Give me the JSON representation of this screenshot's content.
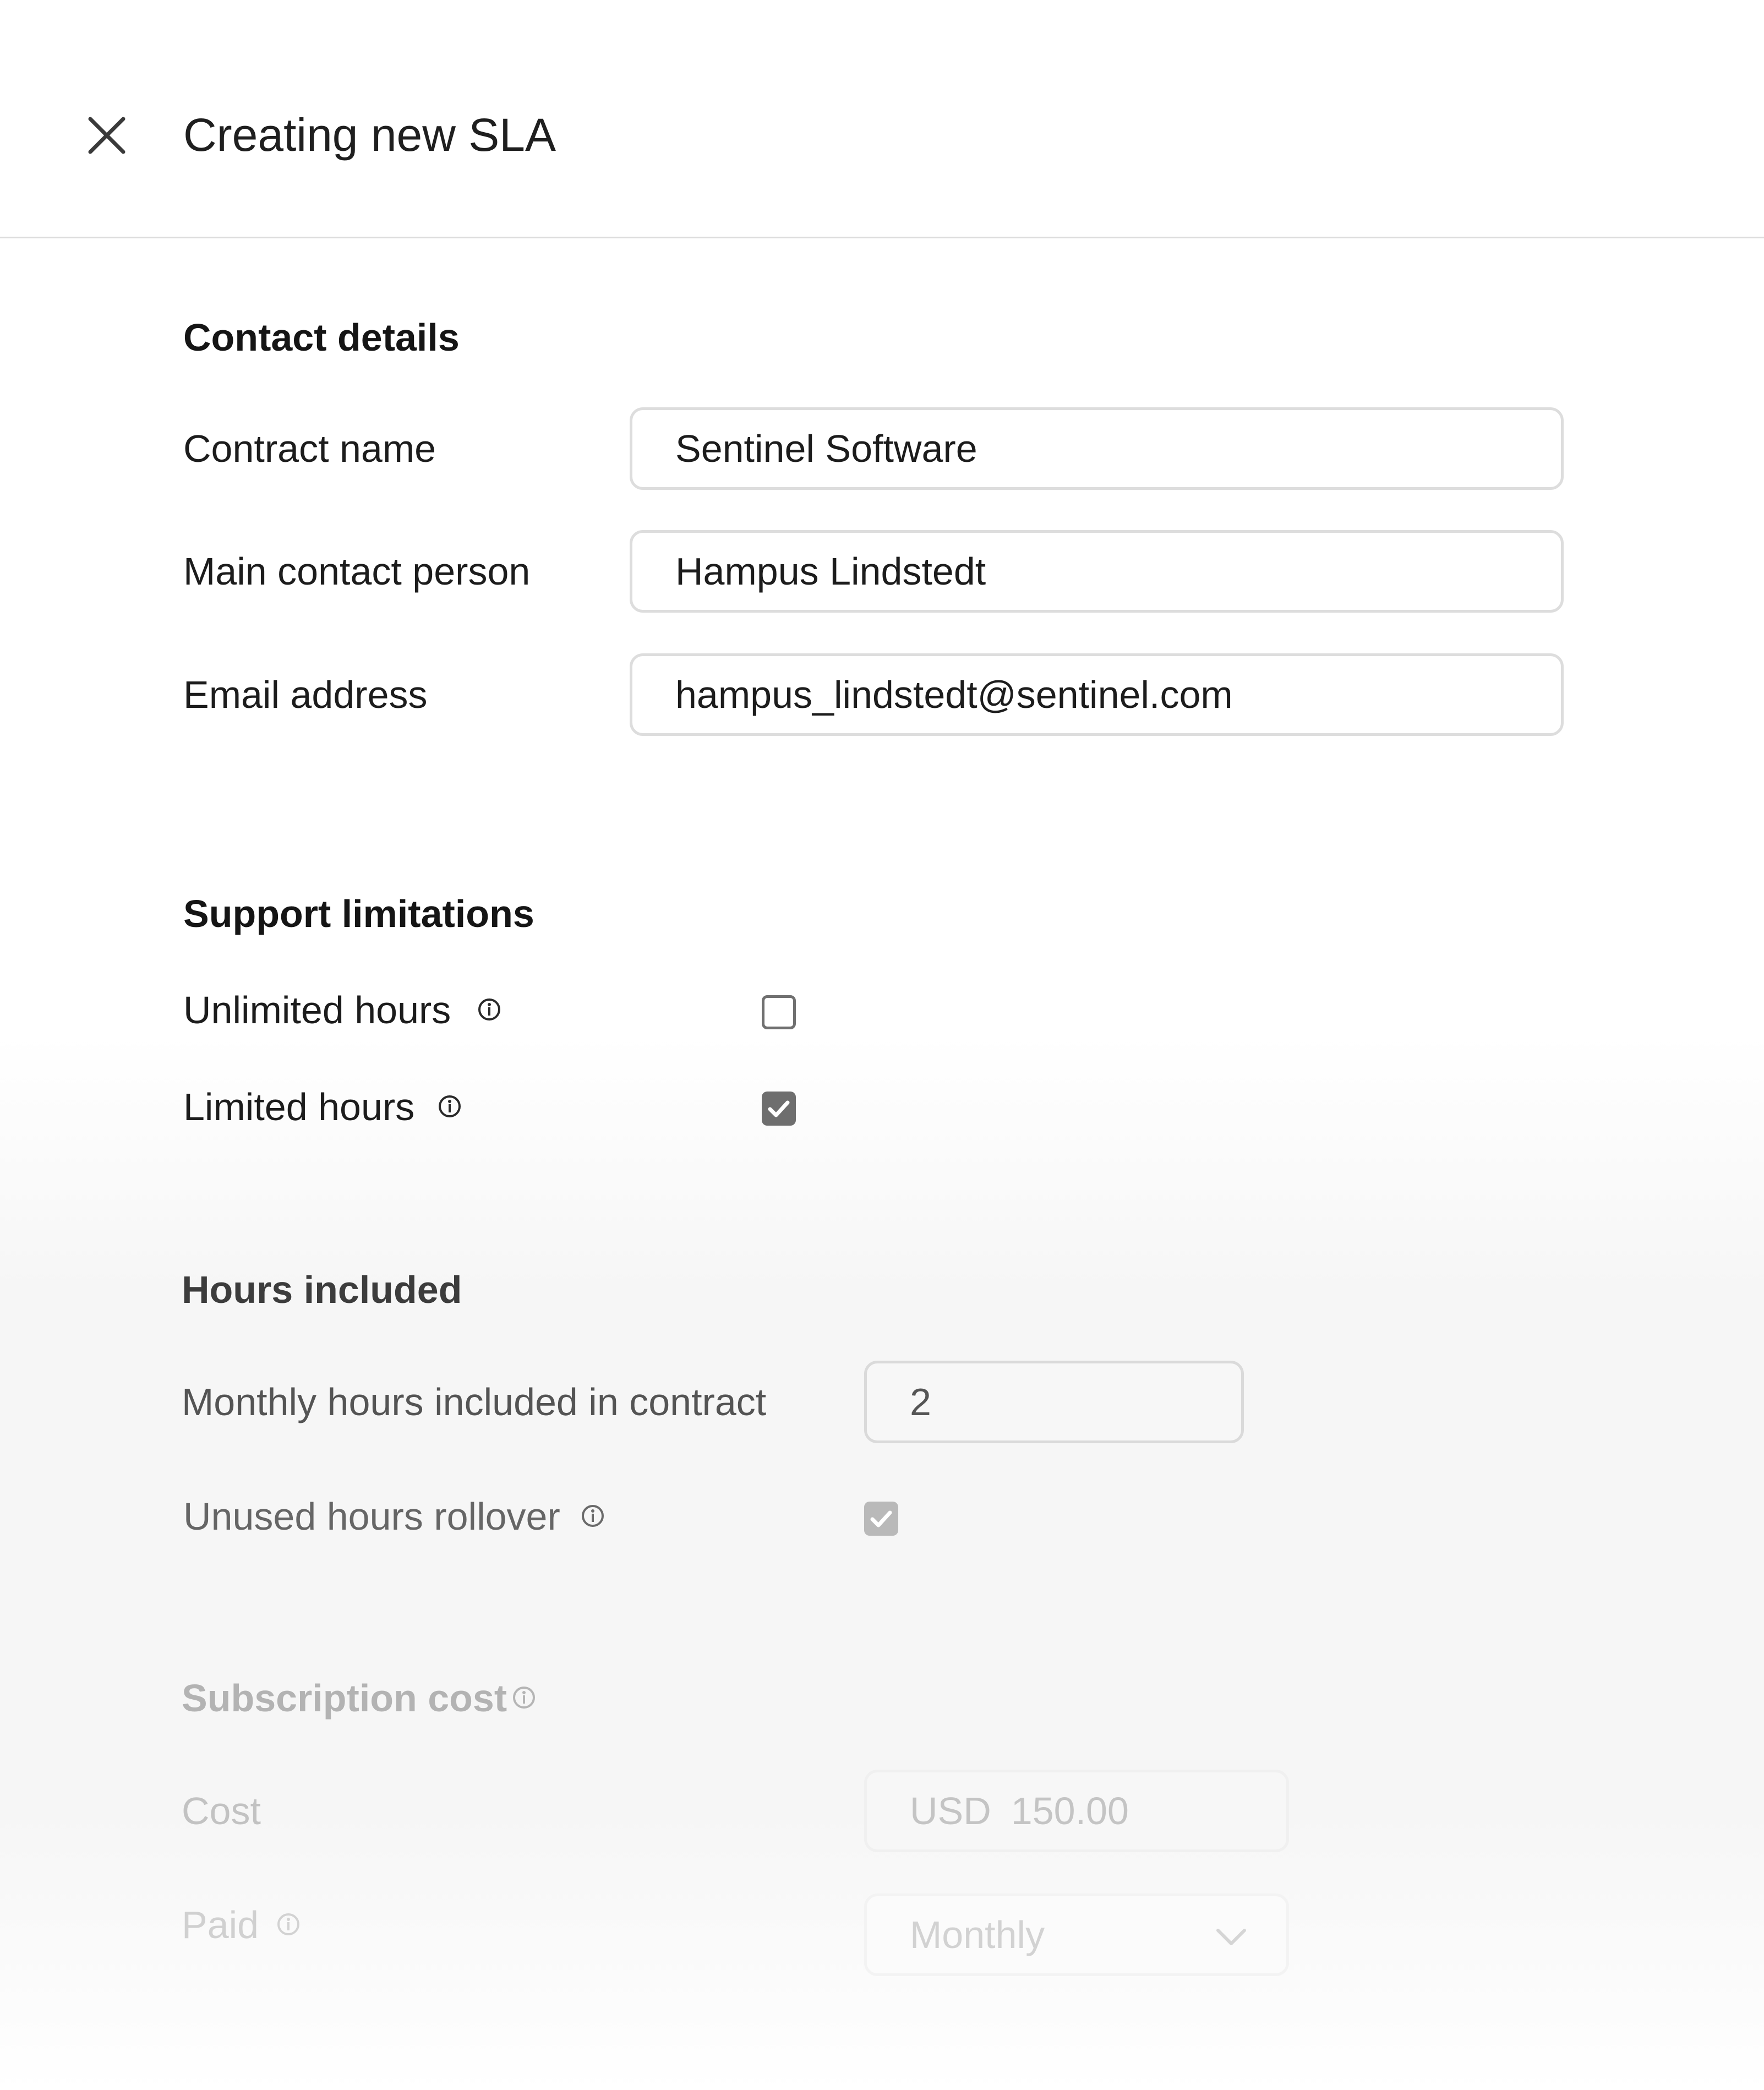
{
  "header": {
    "title": "Creating new SLA"
  },
  "contact_details": {
    "heading": "Contact details",
    "contract_name": {
      "label": "Contract name",
      "value": "Sentinel Software"
    },
    "main_contact": {
      "label": "Main contact person",
      "value": "Hampus Lindstedt"
    },
    "email": {
      "label": "Email address",
      "value": "hampus_lindstedt@sentinel.com"
    }
  },
  "support_limitations": {
    "heading": "Support limitations",
    "unlimited": {
      "label": "Unlimited hours",
      "checked": false
    },
    "limited": {
      "label": "Limited hours",
      "checked": true
    }
  },
  "hours_included": {
    "heading": "Hours included",
    "monthly": {
      "label": "Monthly hours included in contract",
      "value": "2"
    },
    "rollover": {
      "label": "Unused hours rollover",
      "checked": true
    }
  },
  "subscription_cost": {
    "heading": "Subscription cost",
    "cost": {
      "label": "Cost",
      "currency": "USD",
      "value": "150.00"
    },
    "paid": {
      "label": "Paid",
      "value": "Monthly"
    }
  },
  "colors": {
    "text": "#1c1c1c",
    "border": "#dddddd",
    "checkbox_checked": "#6e6e6e"
  },
  "icons": {
    "close": "close-icon",
    "info": "info-icon",
    "check": "check-icon",
    "dropdown": "chevron-down-icon"
  }
}
